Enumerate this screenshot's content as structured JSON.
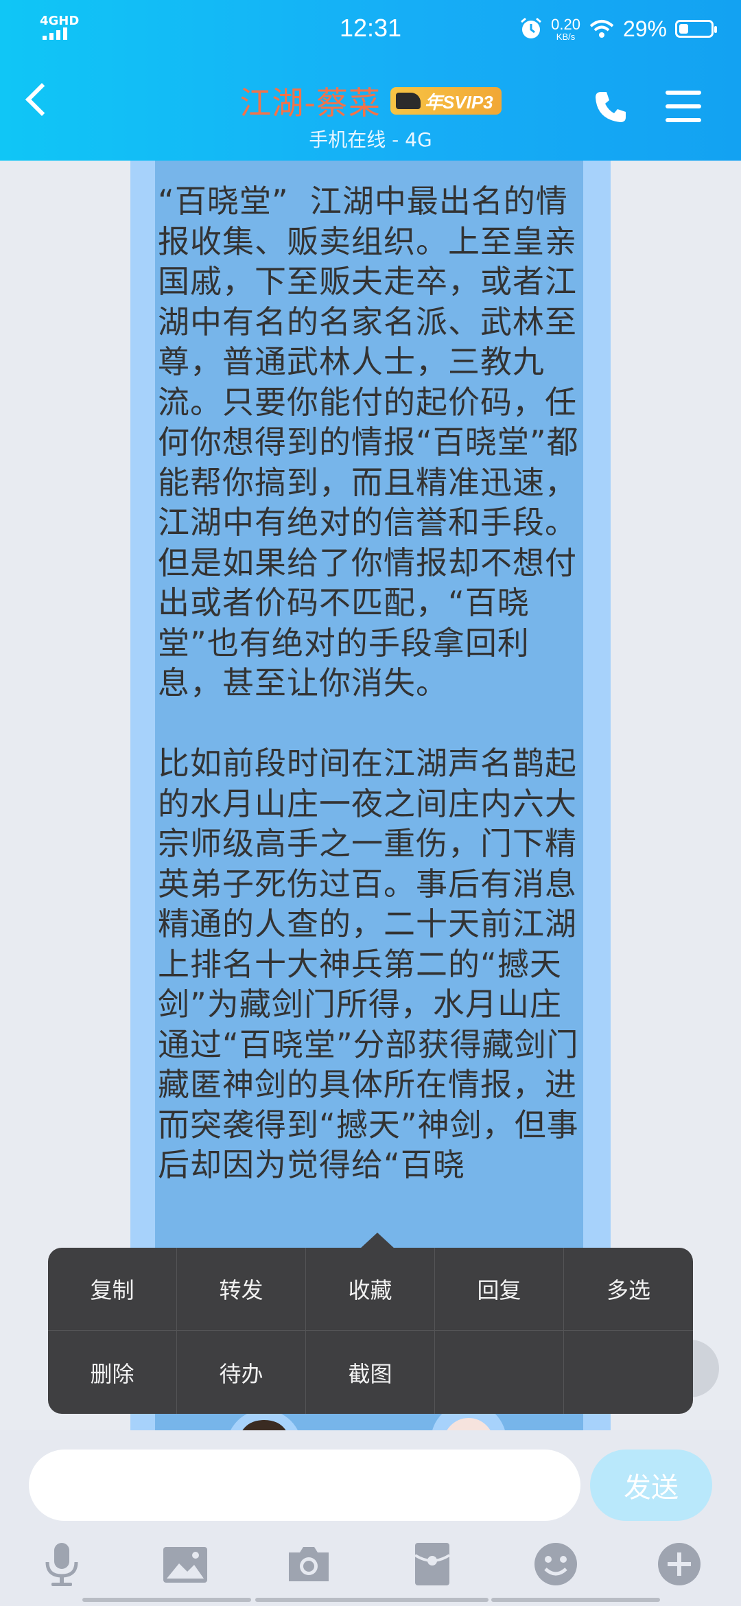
{
  "status_bar": {
    "network": "4GHD",
    "time": "12:31",
    "speed_value": "0.20",
    "speed_unit": "KB/s",
    "battery_pct": "29%",
    "battery_level": 0.29
  },
  "header": {
    "title": "江湖-蔡菜",
    "vip_badge": "年SVIP3",
    "subtitle": "手机在线 - 4G",
    "title_color": "#f2734a",
    "bg_color": "#16aef6"
  },
  "message": {
    "text": "“百晓堂”  江湖中最出名的情报收集、贩卖组织。上至皇亲国戚，下至贩夫走卒，或者江湖中有名的名家名派、武林至尊，普通武林人士，三教九流。只要你能付的起价码，任何你想得到的情报“百晓堂”都能帮你搞到，而且精准迅速，江湖中有绝对的信誉和手段。但是如果给了你情报却不想付出或者价码不匹配，“百晓堂”也有绝对的手段拿回利息，甚至让你消失。\n\n比如前段时间在江湖声名鹊起的水月山庄一夜之间庄内六大宗师级高手之一重伤，门下精英弟子死伤过百。事后有消息精通的人查的，二十天前江湖上排名十大神兵第二的“撼天剑”为藏剑门所得，水月山庄通过“百晓堂”分部获得藏剑门藏匿神剑的具体所在情报，进而突袭得到“撼天”神剑，但事后却因为觉得给“百晓"
  },
  "context_menu": {
    "items": [
      "复制",
      "转发",
      "收藏",
      "回复",
      "多选",
      "删除",
      "待办",
      "截图"
    ]
  },
  "input": {
    "placeholder": "",
    "send_label": "发送"
  },
  "toolbar": {
    "icons": [
      "microphone-icon",
      "image-icon",
      "camera-icon",
      "red-packet-icon",
      "emoji-icon",
      "plus-icon"
    ]
  }
}
